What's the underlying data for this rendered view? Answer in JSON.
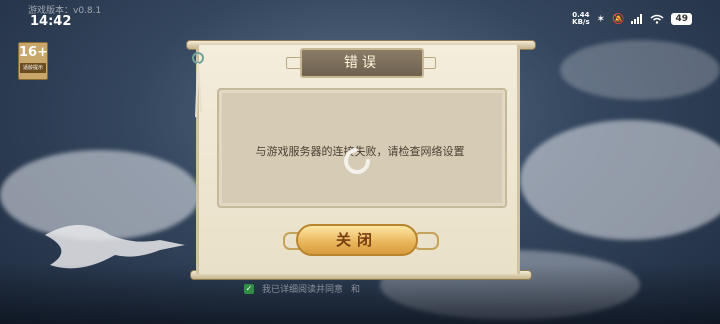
{
  "status_bar": {
    "version": "游戏版本：v0.8.1",
    "time": "14:42",
    "net_speed_value": "0.44",
    "net_speed_unit": "KB/s",
    "battery": "49"
  },
  "age_rating": {
    "number": "16+",
    "label": "适龄提示"
  },
  "dialog": {
    "title": "错误",
    "message": "与游戏服务器的连接失败，请检查网络设置",
    "close_label": "关闭"
  },
  "agreement": {
    "text": "我已详细阅读并同意",
    "link_word": "和"
  },
  "colors": {
    "button_gold": "#e9b45a",
    "button_text": "#7a3d12",
    "checkbox_green": "#2f8d45"
  },
  "icons": [
    "spinner-icon",
    "bluetooth-icon",
    "mute-icon",
    "signal-icon",
    "wifi-icon",
    "battery-icon",
    "checkmark-icon"
  ]
}
